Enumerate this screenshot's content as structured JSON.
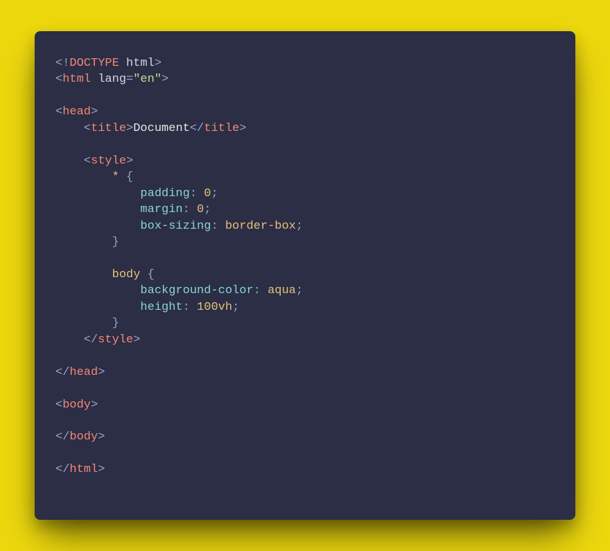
{
  "colors": {
    "background_page": "#edd80e",
    "background_card": "#2b2e44",
    "punctuation": "#9aa3c7",
    "tag": "#f28779",
    "attribute": "#d4d7e6",
    "string": "#bee18a",
    "text": "#e6e6e6",
    "selector": "#e5c07b",
    "property": "#89d4d8",
    "value": "#e5c07b"
  },
  "code": {
    "lines": [
      {
        "tokens": [
          {
            "cls": "punct",
            "t": "<!"
          },
          {
            "cls": "kw",
            "t": "DOCTYPE "
          },
          {
            "cls": "attr",
            "t": "html"
          },
          {
            "cls": "punct",
            "t": ">"
          }
        ]
      },
      {
        "tokens": [
          {
            "cls": "punct",
            "t": "<"
          },
          {
            "cls": "tag",
            "t": "html "
          },
          {
            "cls": "attr",
            "t": "lang"
          },
          {
            "cls": "punct",
            "t": "="
          },
          {
            "cls": "str",
            "t": "\"en\""
          },
          {
            "cls": "punct",
            "t": ">"
          }
        ]
      },
      {
        "tokens": []
      },
      {
        "tokens": [
          {
            "cls": "punct",
            "t": "<"
          },
          {
            "cls": "tag",
            "t": "head"
          },
          {
            "cls": "punct",
            "t": ">"
          }
        ]
      },
      {
        "tokens": [
          {
            "cls": "punct",
            "t": "    <"
          },
          {
            "cls": "tag",
            "t": "title"
          },
          {
            "cls": "punct",
            "t": ">"
          },
          {
            "cls": "text",
            "t": "Document"
          },
          {
            "cls": "punct",
            "t": "</"
          },
          {
            "cls": "tag",
            "t": "title"
          },
          {
            "cls": "punct",
            "t": ">"
          }
        ]
      },
      {
        "tokens": []
      },
      {
        "tokens": [
          {
            "cls": "punct",
            "t": "    <"
          },
          {
            "cls": "tag",
            "t": "style"
          },
          {
            "cls": "punct",
            "t": ">"
          }
        ]
      },
      {
        "tokens": [
          {
            "cls": "punct",
            "t": "        "
          },
          {
            "cls": "sel",
            "t": "*"
          },
          {
            "cls": "punct",
            "t": " {"
          }
        ]
      },
      {
        "tokens": [
          {
            "cls": "punct",
            "t": "            "
          },
          {
            "cls": "prop",
            "t": "padding"
          },
          {
            "cls": "punct",
            "t": ": "
          },
          {
            "cls": "num",
            "t": "0"
          },
          {
            "cls": "punct",
            "t": ";"
          }
        ]
      },
      {
        "tokens": [
          {
            "cls": "punct",
            "t": "            "
          },
          {
            "cls": "prop",
            "t": "margin"
          },
          {
            "cls": "punct",
            "t": ": "
          },
          {
            "cls": "num",
            "t": "0"
          },
          {
            "cls": "punct",
            "t": ";"
          }
        ]
      },
      {
        "tokens": [
          {
            "cls": "punct",
            "t": "            "
          },
          {
            "cls": "prop",
            "t": "box-sizing"
          },
          {
            "cls": "punct",
            "t": ": "
          },
          {
            "cls": "val",
            "t": "border-box"
          },
          {
            "cls": "punct",
            "t": ";"
          }
        ]
      },
      {
        "tokens": [
          {
            "cls": "punct",
            "t": "        }"
          }
        ]
      },
      {
        "tokens": []
      },
      {
        "tokens": [
          {
            "cls": "punct",
            "t": "        "
          },
          {
            "cls": "sel",
            "t": "body"
          },
          {
            "cls": "punct",
            "t": " {"
          }
        ]
      },
      {
        "tokens": [
          {
            "cls": "punct",
            "t": "            "
          },
          {
            "cls": "prop",
            "t": "background-color"
          },
          {
            "cls": "punct",
            "t": ": "
          },
          {
            "cls": "val",
            "t": "aqua"
          },
          {
            "cls": "punct",
            "t": ";"
          }
        ]
      },
      {
        "tokens": [
          {
            "cls": "punct",
            "t": "            "
          },
          {
            "cls": "prop",
            "t": "height"
          },
          {
            "cls": "punct",
            "t": ": "
          },
          {
            "cls": "num",
            "t": "100vh"
          },
          {
            "cls": "punct",
            "t": ";"
          }
        ]
      },
      {
        "tokens": [
          {
            "cls": "punct",
            "t": "        }"
          }
        ]
      },
      {
        "tokens": [
          {
            "cls": "punct",
            "t": "    </"
          },
          {
            "cls": "tag",
            "t": "style"
          },
          {
            "cls": "punct",
            "t": ">"
          }
        ]
      },
      {
        "tokens": []
      },
      {
        "tokens": [
          {
            "cls": "punct",
            "t": "</"
          },
          {
            "cls": "tag",
            "t": "head"
          },
          {
            "cls": "punct",
            "t": ">"
          }
        ]
      },
      {
        "tokens": []
      },
      {
        "tokens": [
          {
            "cls": "punct",
            "t": "<"
          },
          {
            "cls": "tag",
            "t": "body"
          },
          {
            "cls": "punct",
            "t": ">"
          }
        ]
      },
      {
        "tokens": []
      },
      {
        "tokens": [
          {
            "cls": "punct",
            "t": "</"
          },
          {
            "cls": "tag",
            "t": "body"
          },
          {
            "cls": "punct",
            "t": ">"
          }
        ]
      },
      {
        "tokens": []
      },
      {
        "tokens": [
          {
            "cls": "punct",
            "t": "</"
          },
          {
            "cls": "tag",
            "t": "html"
          },
          {
            "cls": "punct",
            "t": ">"
          }
        ]
      }
    ]
  }
}
